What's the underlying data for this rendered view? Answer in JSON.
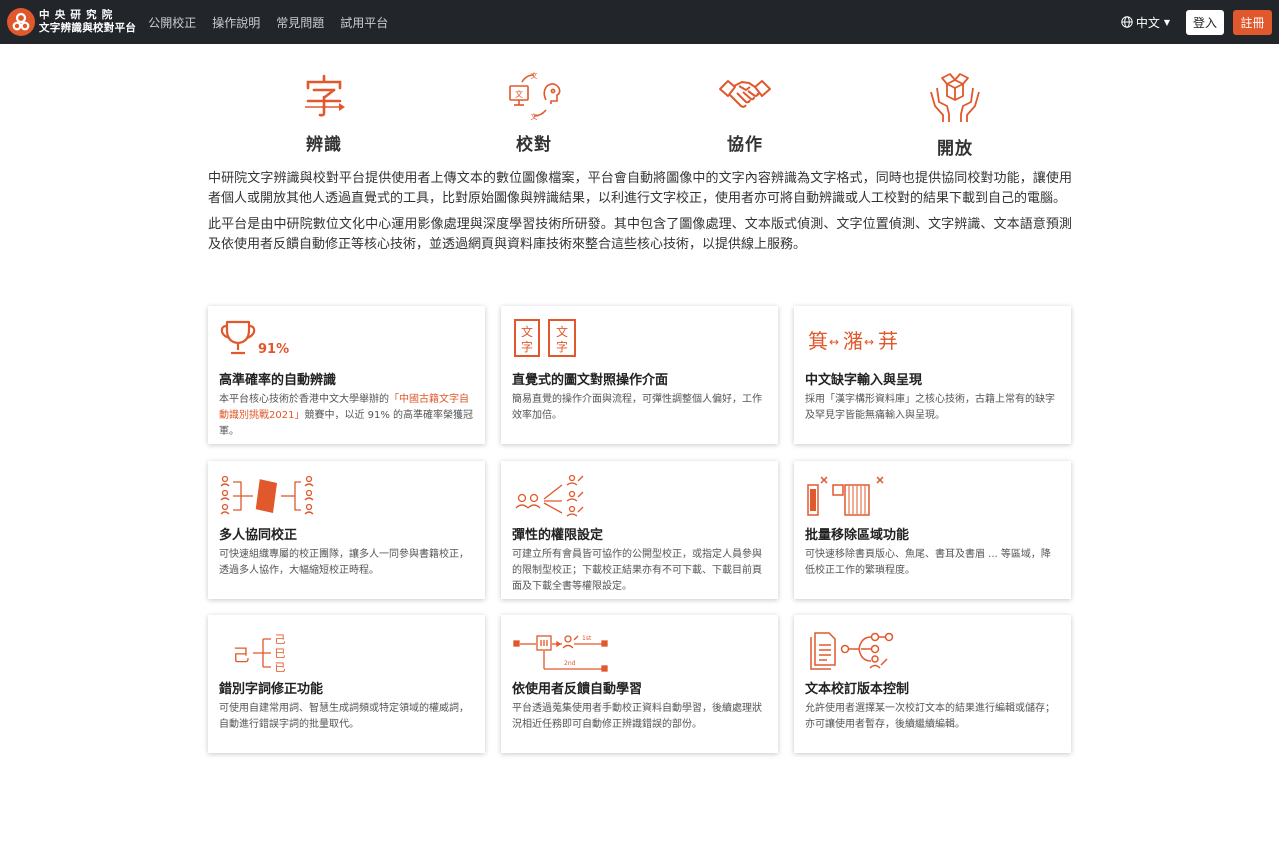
{
  "brand": {
    "line1": "中央研究院",
    "line2": "文字辨識與校對平台"
  },
  "nav": {
    "items": [
      "公開校正",
      "操作說明",
      "常見問題",
      "試用平台"
    ],
    "language": "中文",
    "login": "登入",
    "register": "註冊"
  },
  "features": [
    {
      "label": "辨識",
      "icon": "character-recognition-icon"
    },
    {
      "label": "校對",
      "icon": "proofreading-icon"
    },
    {
      "label": "協作",
      "icon": "handshake-icon"
    },
    {
      "label": "開放",
      "icon": "open-box-icon"
    }
  ],
  "intro": {
    "p1": "中研院文字辨識與校對平台提供使用者上傳文本的數位圖像檔案，平台會自動將圖像中的文字內容辨識為文字格式，同時也提供協同校對功能，讓使用者個人或開放其他人透過直覺式的工具，比對原始圖像與辨識結果，以利進行文字校正，使用者亦可將自動辨識或人工校對的結果下載到自己的電腦。",
    "p2": "此平台是由中研院數位文化中心運用影像處理與深度學習技術所研發。其中包含了圖像處理、文本版式偵測、文字位置偵測、文字辨識、文本語意預測及依使用者反饋自動修正等核心技術，並透過網頁與資料庫技術來整合這些核心技術，以提供線上服務。"
  },
  "cards": [
    {
      "title": "高準確率的自動辨識",
      "desc_pre": "本平台核心技術於香港中文大學舉辦的",
      "desc_hl": "「中國古籍文字自動識別挑戰2021」",
      "desc_post": "競賽中，以近 91% 的高準確率榮獲冠軍。",
      "icon_text": "91%",
      "icon": "trophy-icon"
    },
    {
      "title": "直覺式的圖文對照操作介面",
      "desc": "簡易直覺的操作介面與流程，可彈性調整個人偏好，工作效率加倍。",
      "icon_chars": [
        "文",
        "字",
        "文",
        "字"
      ],
      "icon": "side-by-side-text-icon"
    },
    {
      "title": "中文缺字輸入與呈現",
      "desc": "採用「漢字構形資料庫」之核心技術，古籍上常有的缺字及罕見字皆能無痛輸入與呈現。",
      "icon_chars": [
        "箕",
        "↔",
        "潴",
        "↔",
        "荓"
      ],
      "icon": "rare-character-icon"
    },
    {
      "title": "多人協同校正",
      "desc": "可快速組織專屬的校正團隊，讓多人一同參與書籍校正，透過多人協作，大幅縮短校正時程。",
      "icon": "team-collaboration-icon"
    },
    {
      "title": "彈性的權限設定",
      "desc": "可建立所有會員皆可協作的公開型校正，或指定人員參與的限制型校正；下載校正結果亦有不可下載、下載目前頁面及下載全書等權限設定。",
      "icon": "permission-icon"
    },
    {
      "title": "批量移除區域功能",
      "desc": "可快速移除書頁版心、魚尾、書耳及書眉 ... 等區域，降低校正工作的繁瑣程度。",
      "icon": "batch-remove-icon"
    },
    {
      "title": "錯別字詞修正功能",
      "desc": "可使用自建常用詞、智慧生成詞頻或特定領域的權威詞，自動進行錯誤字詞的批量取代。",
      "icon_chars": [
        "己",
        "己",
        "巳",
        "已"
      ],
      "icon": "typo-correction-icon"
    },
    {
      "title": "依使用者反饋自動學習",
      "desc": "平台透過蒐集使用者手動校正資料自動學習，後續處理狀況相近任務即可自動修正辨識錯誤的部份。",
      "icon_labels": [
        "1st",
        "2nd"
      ],
      "icon": "feedback-learning-icon"
    },
    {
      "title": "文本校訂版本控制",
      "desc": "允許使用者選擇某一次校訂文本的結果進行編輯或儲存；亦可讓使用者暫存，後續繼續編輯。",
      "icon": "version-control-icon"
    }
  ],
  "colors": {
    "accent": "#e0582b",
    "navbar": "#22262b"
  }
}
